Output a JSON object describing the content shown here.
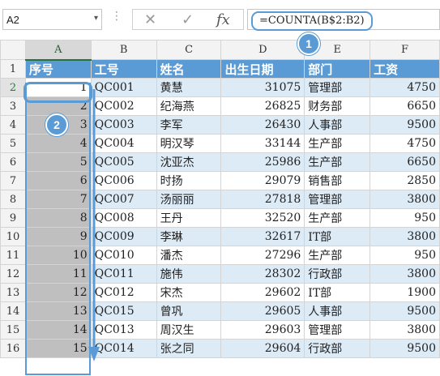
{
  "name_box": "A2",
  "formula": "=COUNTA(B$2:B2)",
  "callouts": [
    "1",
    "2"
  ],
  "columns": [
    "A",
    "B",
    "C",
    "D",
    "E",
    "F"
  ],
  "header_row": {
    "row": "1",
    "cells": [
      "序号",
      "工号",
      "姓名",
      "出生日期",
      "部门",
      "工资"
    ]
  },
  "rows": [
    {
      "row": "2",
      "cells": [
        "1",
        "QC001",
        "黄慧",
        "31075",
        "管理部",
        "4750"
      ]
    },
    {
      "row": "3",
      "cells": [
        "2",
        "QC002",
        "纪海燕",
        "26825",
        "财务部",
        "6650"
      ]
    },
    {
      "row": "4",
      "cells": [
        "3",
        "QC003",
        "李军",
        "26430",
        "人事部",
        "9500"
      ]
    },
    {
      "row": "5",
      "cells": [
        "4",
        "QC004",
        "明汉琴",
        "33144",
        "生产部",
        "4750"
      ]
    },
    {
      "row": "6",
      "cells": [
        "5",
        "QC005",
        "沈亚杰",
        "25986",
        "生产部",
        "6650"
      ]
    },
    {
      "row": "7",
      "cells": [
        "6",
        "QC006",
        "时扬",
        "29079",
        "销售部",
        "2850"
      ]
    },
    {
      "row": "8",
      "cells": [
        "7",
        "QC007",
        "汤丽丽",
        "27818",
        "管理部",
        "3800"
      ]
    },
    {
      "row": "9",
      "cells": [
        "8",
        "QC008",
        "王丹",
        "32520",
        "生产部",
        "950"
      ]
    },
    {
      "row": "10",
      "cells": [
        "9",
        "QC009",
        "李琳",
        "32617",
        "IT部",
        "3800"
      ]
    },
    {
      "row": "11",
      "cells": [
        "10",
        "QC010",
        "潘杰",
        "27296",
        "生产部",
        "950"
      ]
    },
    {
      "row": "12",
      "cells": [
        "11",
        "QC011",
        "施伟",
        "28302",
        "行政部",
        "3800"
      ]
    },
    {
      "row": "13",
      "cells": [
        "12",
        "QC012",
        "宋杰",
        "29602",
        "IT部",
        "1900"
      ]
    },
    {
      "row": "14",
      "cells": [
        "13",
        "QC015",
        "曾巩",
        "29605",
        "人事部",
        "9500"
      ]
    },
    {
      "row": "15",
      "cells": [
        "14",
        "QC013",
        "周汉生",
        "29603",
        "管理部",
        "3800"
      ]
    },
    {
      "row": "16",
      "cells": [
        "15",
        "QC014",
        "张之同",
        "29604",
        "行政部",
        "9500"
      ]
    }
  ],
  "colors": {
    "header_fill": "#5b9bd5",
    "band_fill": "#ddebf7",
    "selection_fill": "#bfbfbf",
    "accent": "#5b9bd5"
  },
  "icons": [
    "cancel-icon",
    "enter-icon",
    "function-icon",
    "dropdown-icon",
    "arrow-icon"
  ]
}
